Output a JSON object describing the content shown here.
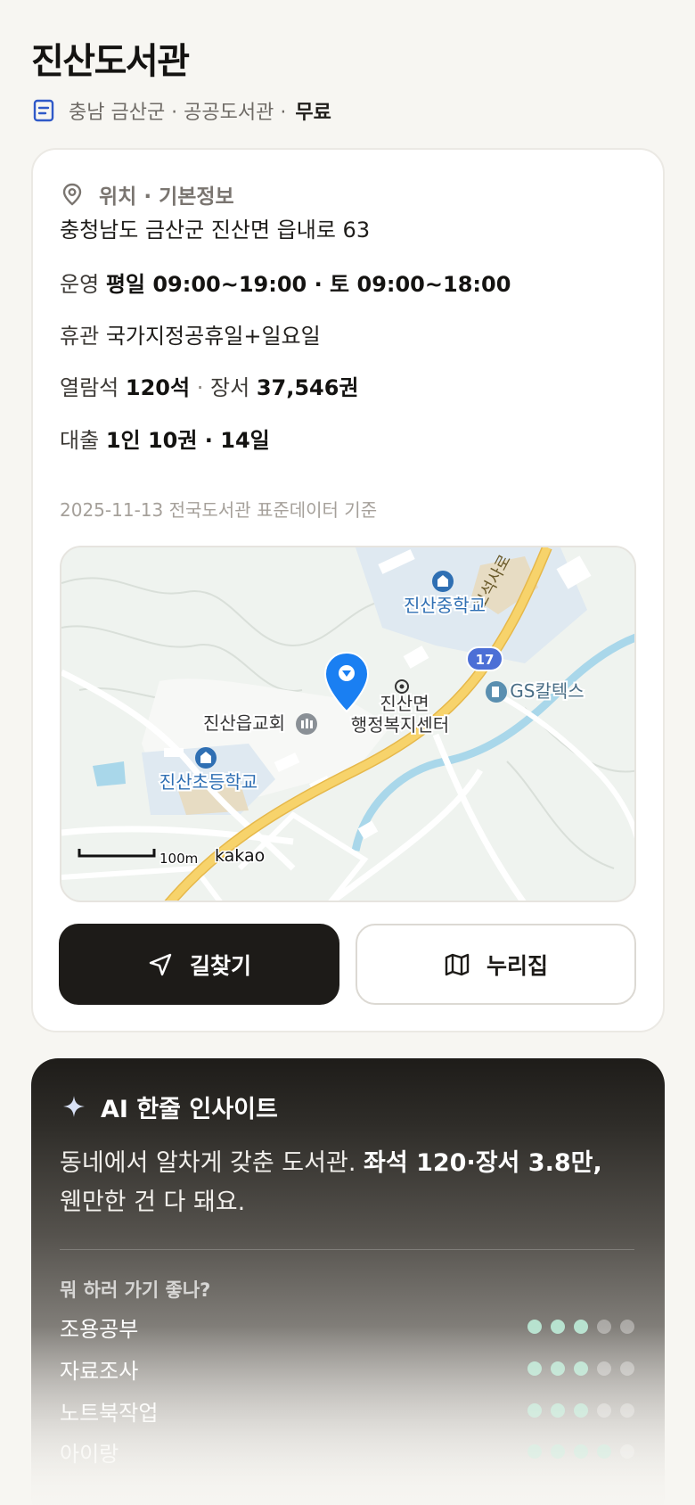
{
  "header": {
    "title": "진산도서관",
    "region": "충남 금산군 · 공공도서관 ·",
    "fee": "무료"
  },
  "info": {
    "section_title": "위치 · 기본정보",
    "address": "충청남도 금산군 진산면 읍내로 63",
    "hours_label": "운영",
    "hours_value": "평일 09:00~19:00 · 토 09:00~18:00",
    "closed_label": "휴관",
    "closed_value": "국가지정공휴일+일요일",
    "seats_label": "열람석",
    "seats_value": "120석",
    "sep": "·",
    "books_label": "장서",
    "books_value": "37,546권",
    "loan_label": "대출",
    "loan_value": "1인 10권 · 14일",
    "source": "2025-11-13 전국도서관 표준데이터 기준"
  },
  "map": {
    "labels": {
      "middle_school": "진산중학교",
      "church": "진산읍교회",
      "office_line1": "진산면",
      "office_line2": "행정복지센터",
      "elementary": "진산초등학교",
      "gas": "GS칼텍스",
      "route": "17",
      "road": "보석사로",
      "scale": "100m",
      "brand": "kakao"
    },
    "colors": {
      "road_main": "#f7d36b",
      "water": "#a9d7ea",
      "poi_blue": "#2f6fb3",
      "pin": "#1a7ff2"
    }
  },
  "actions": {
    "directions": "길찾기",
    "nurijip": "누리집"
  },
  "ai": {
    "title": "AI 한줄 인사이트",
    "text_plain": "동네에서 알차게 갖춘 도서관.",
    "text_bold": "좌석 120·장서 3.8만,",
    "text_tail": "웬만한 건 다 돼요.",
    "question": "뭐 하러 가기 좋나?",
    "activities": [
      {
        "name": "조용공부",
        "level": 3,
        "max": 5
      },
      {
        "name": "자료조사",
        "level": 3,
        "max": 5
      },
      {
        "name": "노트북작업",
        "level": 3,
        "max": 5
      },
      {
        "name": "아이랑",
        "level": 4,
        "max": 5
      }
    ]
  }
}
